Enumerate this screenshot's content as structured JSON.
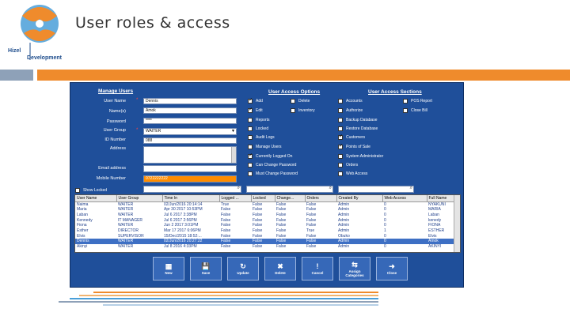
{
  "slide": {
    "title": "User roles & access",
    "logo_line1": "Hizel",
    "logo_line2": "Development"
  },
  "form": {
    "heading": "Manage Users",
    "fields": [
      {
        "label": "User Name",
        "value": "Dennis",
        "required": true
      },
      {
        "label": "Name(s)",
        "value": "Amok",
        "required": false
      },
      {
        "label": "Password",
        "value": "****",
        "required": false
      },
      {
        "label": "User Group",
        "value": "WAITER",
        "required": true
      },
      {
        "label": "ID Number",
        "value": "088",
        "required": false
      },
      {
        "label": "Address",
        "value": "",
        "required": false
      },
      {
        "label": "Email address",
        "value": "",
        "required": false
      },
      {
        "label": "Mobile Number",
        "value": "0722222222",
        "required": false
      }
    ],
    "show_locked": "Show Locked",
    "required_mark": "*"
  },
  "access_options": {
    "heading": "User Access Options",
    "col1": [
      {
        "label": "Add",
        "checked": true
      },
      {
        "label": "Edit",
        "checked": true
      },
      {
        "label": "Reports",
        "checked": false
      },
      {
        "label": "Locked",
        "checked": false
      },
      {
        "label": "Audit Logs",
        "checked": false
      },
      {
        "label": "Manage Users",
        "checked": false
      },
      {
        "label": "Currently Logged On",
        "checked": true
      },
      {
        "label": "Can Change Password",
        "checked": false
      },
      {
        "label": "Must Change Password",
        "checked": false
      }
    ],
    "col2": [
      {
        "label": "Delete",
        "checked": false
      },
      {
        "label": "Inventory",
        "checked": false
      }
    ]
  },
  "access_sections": {
    "heading": "User Access Sections",
    "col1": [
      {
        "label": "Accounts",
        "checked": false
      },
      {
        "label": "Authorize",
        "checked": false
      },
      {
        "label": "Backup Database",
        "checked": false
      },
      {
        "label": "Restore Database",
        "checked": false
      },
      {
        "label": "Customers",
        "checked": true
      },
      {
        "label": "Points of Sale",
        "checked": true
      },
      {
        "label": "System Administrator",
        "checked": false
      },
      {
        "label": "Orders",
        "checked": false
      },
      {
        "label": "Web Access",
        "checked": false
      }
    ],
    "col2": [
      {
        "label": "POS Report",
        "checked": false
      },
      {
        "label": "Close Bill",
        "checked": false
      }
    ]
  },
  "grid": {
    "columns": [
      "User Name",
      "User Group",
      "Time In",
      "Logged ...",
      "Locked",
      "Change...",
      "Orders",
      "Created By",
      "Web Access",
      "Full Name"
    ],
    "rows": [
      [
        "Naima",
        "WAITER",
        "02/Jun/2016 20:14:14",
        "True",
        "False",
        "False",
        "False",
        "Admin",
        "0",
        "NYAKUNI"
      ],
      [
        "Maria",
        "WAITER",
        "Apr 30 2017 10:53PM",
        "False",
        "False",
        "False",
        "False",
        "Admin",
        "0",
        "MARIA"
      ],
      [
        "Laban",
        "WAITER",
        "Jul 6 2017 3:38PM",
        "False",
        "False",
        "False",
        "False",
        "Admin",
        "0",
        "Laban"
      ],
      [
        "Kennedy",
        "IT MANAGER",
        "Jul 6 2017 2:56PM",
        "False",
        "False",
        "False",
        "False",
        "Admin",
        "0",
        "kenedy"
      ],
      [
        "Fiona",
        "WAITER",
        "Jun 2 2017 3:01PM",
        "False",
        "False",
        "False",
        "False",
        "Admin",
        "0",
        "FIONA"
      ],
      [
        "Esther",
        "DIRECTOR",
        "Mar 17 2017 6:06PM",
        "False",
        "False",
        "False",
        "True",
        "Admin",
        "1",
        "ESTHER"
      ],
      [
        "Elvis",
        "SUPERVISOR",
        "15/Dec/2015 18:52:...",
        "False",
        "False",
        "False",
        "False",
        "Obuko",
        "0",
        "Elvis"
      ],
      [
        "Dennis",
        "WAITER",
        "02/Jun/2016 20:27:22",
        "False",
        "False",
        "False",
        "False",
        "Admin",
        "0",
        "Amok"
      ],
      [
        "Akinyi",
        "WAITER",
        "Jul 8 2016 4:33PM",
        "False",
        "False",
        "False",
        "False",
        "Admin",
        "0",
        "AKINYI"
      ]
    ],
    "selected_row": 7
  },
  "toolbar": [
    {
      "label": "New",
      "icon": "new-doc-icon",
      "glyph": "▦"
    },
    {
      "label": "Save",
      "icon": "floppy-disk-icon",
      "glyph": "💾"
    },
    {
      "label": "Update",
      "icon": "update-icon",
      "glyph": "↻"
    },
    {
      "label": "Delete",
      "icon": "delete-x-icon",
      "glyph": "✖"
    },
    {
      "label": "Cancel",
      "icon": "cancel-exclamation-icon",
      "glyph": "!"
    },
    {
      "label": "Assign Categories",
      "icon": "assign-arrow-icon",
      "glyph": "⇆"
    },
    {
      "label": "Close",
      "icon": "close-arrow-icon",
      "glyph": "➜"
    }
  ],
  "colors": {
    "accent_orange": "#ef8b2c",
    "accent_gray": "#8ea1b8",
    "app_blue": "#1f4f9a"
  }
}
